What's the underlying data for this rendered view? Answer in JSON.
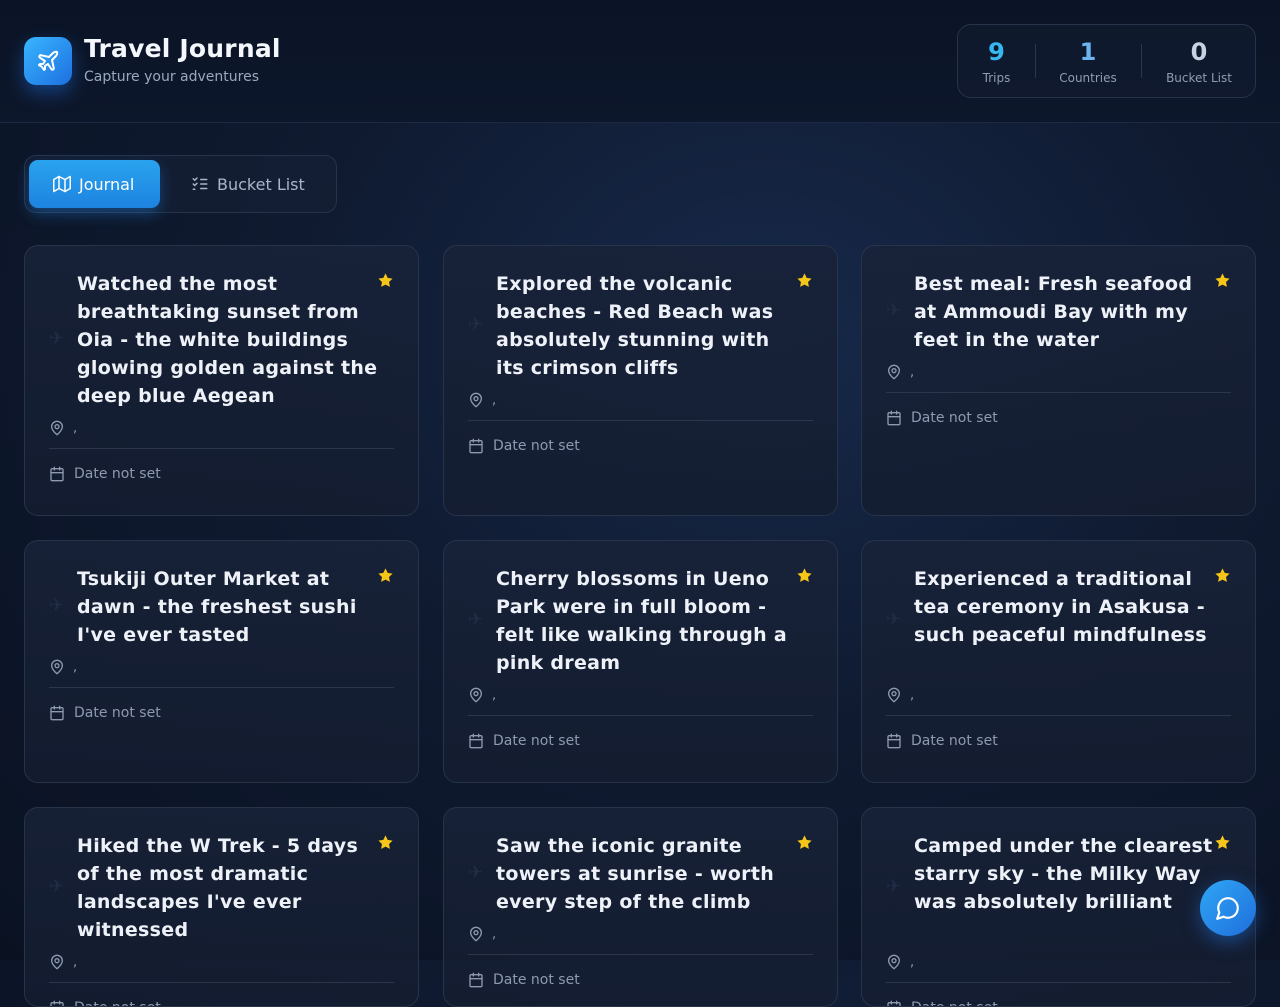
{
  "header": {
    "title": "Travel Journal",
    "subtitle": "Capture your adventures",
    "logo_icon": "airplane-icon"
  },
  "stats": [
    {
      "value": "9",
      "label": "Trips",
      "color": "#35b8f0"
    },
    {
      "value": "1",
      "label": "Countries",
      "color": "#6db4ef"
    },
    {
      "value": "0",
      "label": "Bucket List",
      "color": "#c9d2e0"
    }
  ],
  "tabs": [
    {
      "label": "Journal",
      "icon": "map-icon",
      "active": true
    },
    {
      "label": "Bucket List",
      "icon": "checklist-icon",
      "active": false
    }
  ],
  "entries": [
    {
      "text": "Watched the most breathtaking sunset from Oia - the white buildings glowing golden against the deep blue Aegean",
      "location": ",",
      "date": "Date not set"
    },
    {
      "text": "Explored the volcanic beaches - Red Beach was absolutely stunning with its crimson cliffs",
      "location": ",",
      "date": "Date not set"
    },
    {
      "text": "Best meal: Fresh seafood at Ammoudi Bay with my feet in the water",
      "location": ",",
      "date": "Date not set"
    },
    {
      "text": "Tsukiji Outer Market at dawn - the freshest sushi I've ever tasted",
      "location": ",",
      "date": "Date not set"
    },
    {
      "text": "Cherry blossoms in Ueno Park were in full bloom - felt like walking through a pink dream",
      "location": ",",
      "date": "Date not set"
    },
    {
      "text": "Experienced a traditional tea ceremony in Asakusa - such peaceful mindfulness",
      "location": ",",
      "date": "Date not set"
    },
    {
      "text": "Hiked the W Trek - 5 days of the most dramatic landscapes I've ever witnessed",
      "location": ",",
      "date": "Date not set"
    },
    {
      "text": "Saw the iconic granite towers at sunrise - worth every step of the climb",
      "location": ",",
      "date": "Date not set"
    },
    {
      "text": "Camped under the clearest starry sky - the Milky Way was absolutely brilliant",
      "location": ",",
      "date": "Date not set"
    }
  ],
  "colors": {
    "accent": "#1d83e0",
    "star": "#f5c518"
  },
  "chat_icon": "chat-bubble-icon"
}
